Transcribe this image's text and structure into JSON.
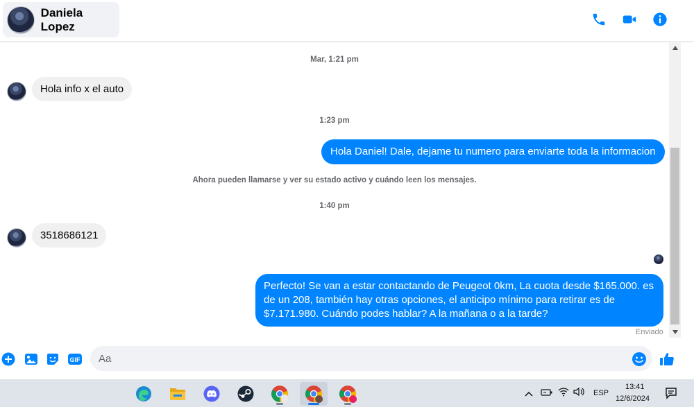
{
  "header": {
    "contact_name": "Daniela Lopez",
    "call_icon": "phone-icon",
    "video_icon": "video-camera-icon",
    "info_icon": "info-icon",
    "accent_color": "#0084ff"
  },
  "conversation": {
    "ts1": "Mar, 1:21 pm",
    "msg1": "Hola info x el auto",
    "ts2": "1:23 pm",
    "msg2": "Hola Daniel! Dale, dejame tu numero para enviarte toda la informacion",
    "notice": "Ahora pueden llamarse y ver su estado activo y cuándo leen los mensajes.",
    "ts3": "1:40 pm",
    "msg3": "3518686121",
    "msg4_line1": "Perfecto!  Se van a estar contactando de Peugeot 0km, La cuota desde $165.000. es",
    "msg4_line2": "de un 208, también hay otras opciones, el anticipo mínimo para retirar es de",
    "msg4_line3": "$7.171.980. Cuándo podes hablar? A la mañana o a la tarde?",
    "status": "Enviado",
    "incoming_bubble_color": "#f0f0f0",
    "outgoing_bubble_color": "#0084ff"
  },
  "composer": {
    "placeholder": "Aa",
    "icons": [
      "plus-icon",
      "photo-icon",
      "sticker-icon",
      "gif-icon",
      "emoji-icon",
      "like-icon"
    ],
    "gif_label": "GIF"
  },
  "taskbar": {
    "apps": [
      "edge-icon",
      "file-explorer-icon",
      "discord-icon",
      "steam-icon",
      "chrome-icon",
      "chrome-icon",
      "chrome-icon"
    ],
    "language": "ESP",
    "time": "13:41",
    "date": "12/6/2024"
  }
}
